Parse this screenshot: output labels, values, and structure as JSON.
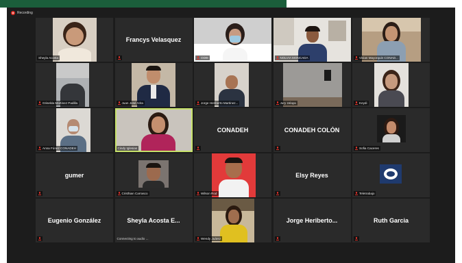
{
  "recording": {
    "label": "Recording"
  },
  "tiles": [
    {
      "name": "Sheyla Acosta"
    },
    {
      "big": "Francys Velasquez"
    },
    {
      "name": "ODI8"
    },
    {
      "name": "NOLVIA MONCADA"
    },
    {
      "name": "Vivian Mayorquin CONAD..."
    },
    {
      "name": "Griselda Martinez Padilla"
    },
    {
      "name": "Juan José Arita"
    },
    {
      "name": "Jorge Heriberto Martinez..."
    },
    {
      "name": "Jury zelaya"
    },
    {
      "name": "Keydi"
    },
    {
      "name": "Anna Fúnez CONADEH"
    },
    {
      "name": "Cindy Iglesias"
    },
    {
      "big": "CONADEH"
    },
    {
      "big": "CONADEH COLÓN"
    },
    {
      "name": "Sofia Caceres"
    },
    {
      "big": "gumer"
    },
    {
      "name": "Cristhian Carrasco"
    },
    {
      "name": "Wilson Rod"
    },
    {
      "big": "Elsy Reyes"
    },
    {
      "name": "Teletrabajo"
    },
    {
      "big": "Eugenio González"
    },
    {
      "big": "Sheyla Acosta E...",
      "status": "Connecting to audio ..."
    },
    {
      "name": "Wendy Juárez"
    },
    {
      "big": "Jorge Heriberto..."
    },
    {
      "big": "Ruth Garcia"
    }
  ]
}
